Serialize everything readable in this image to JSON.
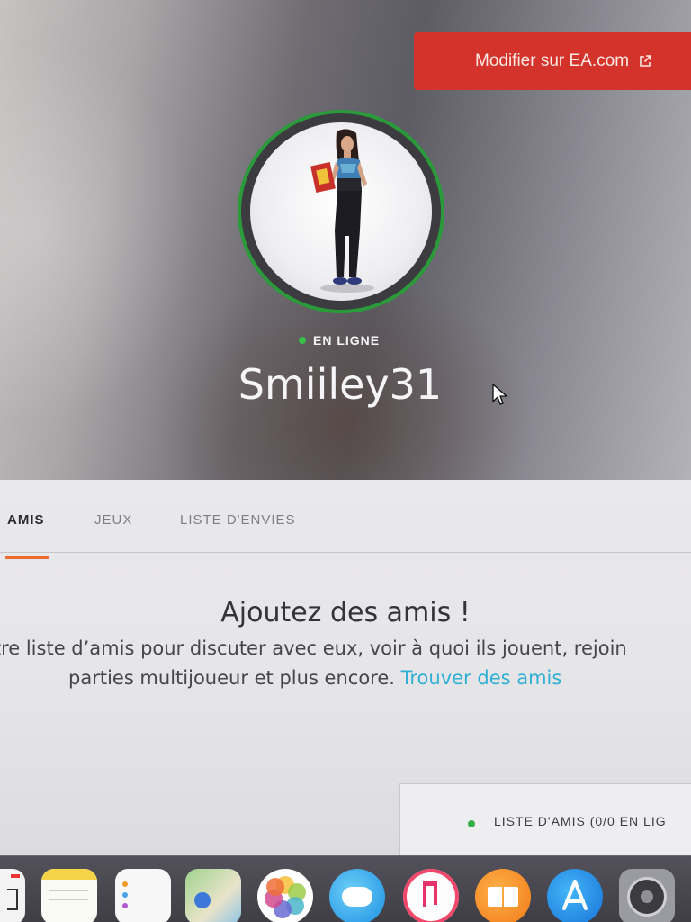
{
  "header": {
    "edit_button_label": "Modifier sur EA.com",
    "status_label": "EN LIGNE",
    "username": "Smiiley31"
  },
  "tabs": [
    {
      "label": "AMIS",
      "active": true
    },
    {
      "label": "JEUX",
      "active": false
    },
    {
      "label": "LISTE D'ENVIES",
      "active": false
    }
  ],
  "empty_state": {
    "title": "Ajoutez des amis !",
    "line1": "otre liste d’amis pour discuter avec eux, voir à quoi ils jouent, rejoin",
    "line2": "parties multijoueur et plus encore.",
    "link_label": "Trouver des amis"
  },
  "friends_bar": {
    "label": "LISTE D'AMIS (0/0 EN LIG"
  },
  "dock": {
    "icons": [
      "calendar-icon",
      "notes-icon",
      "reminders-icon",
      "maps-icon",
      "photos-icon",
      "messages-icon",
      "music-icon",
      "books-icon",
      "app-store-icon",
      "system-preferences-icon"
    ]
  },
  "colors": {
    "accent_red": "#d3332a",
    "online_green": "#34c24a",
    "tab_underline": "#ee6a2e",
    "link": "#2fb0d4"
  }
}
